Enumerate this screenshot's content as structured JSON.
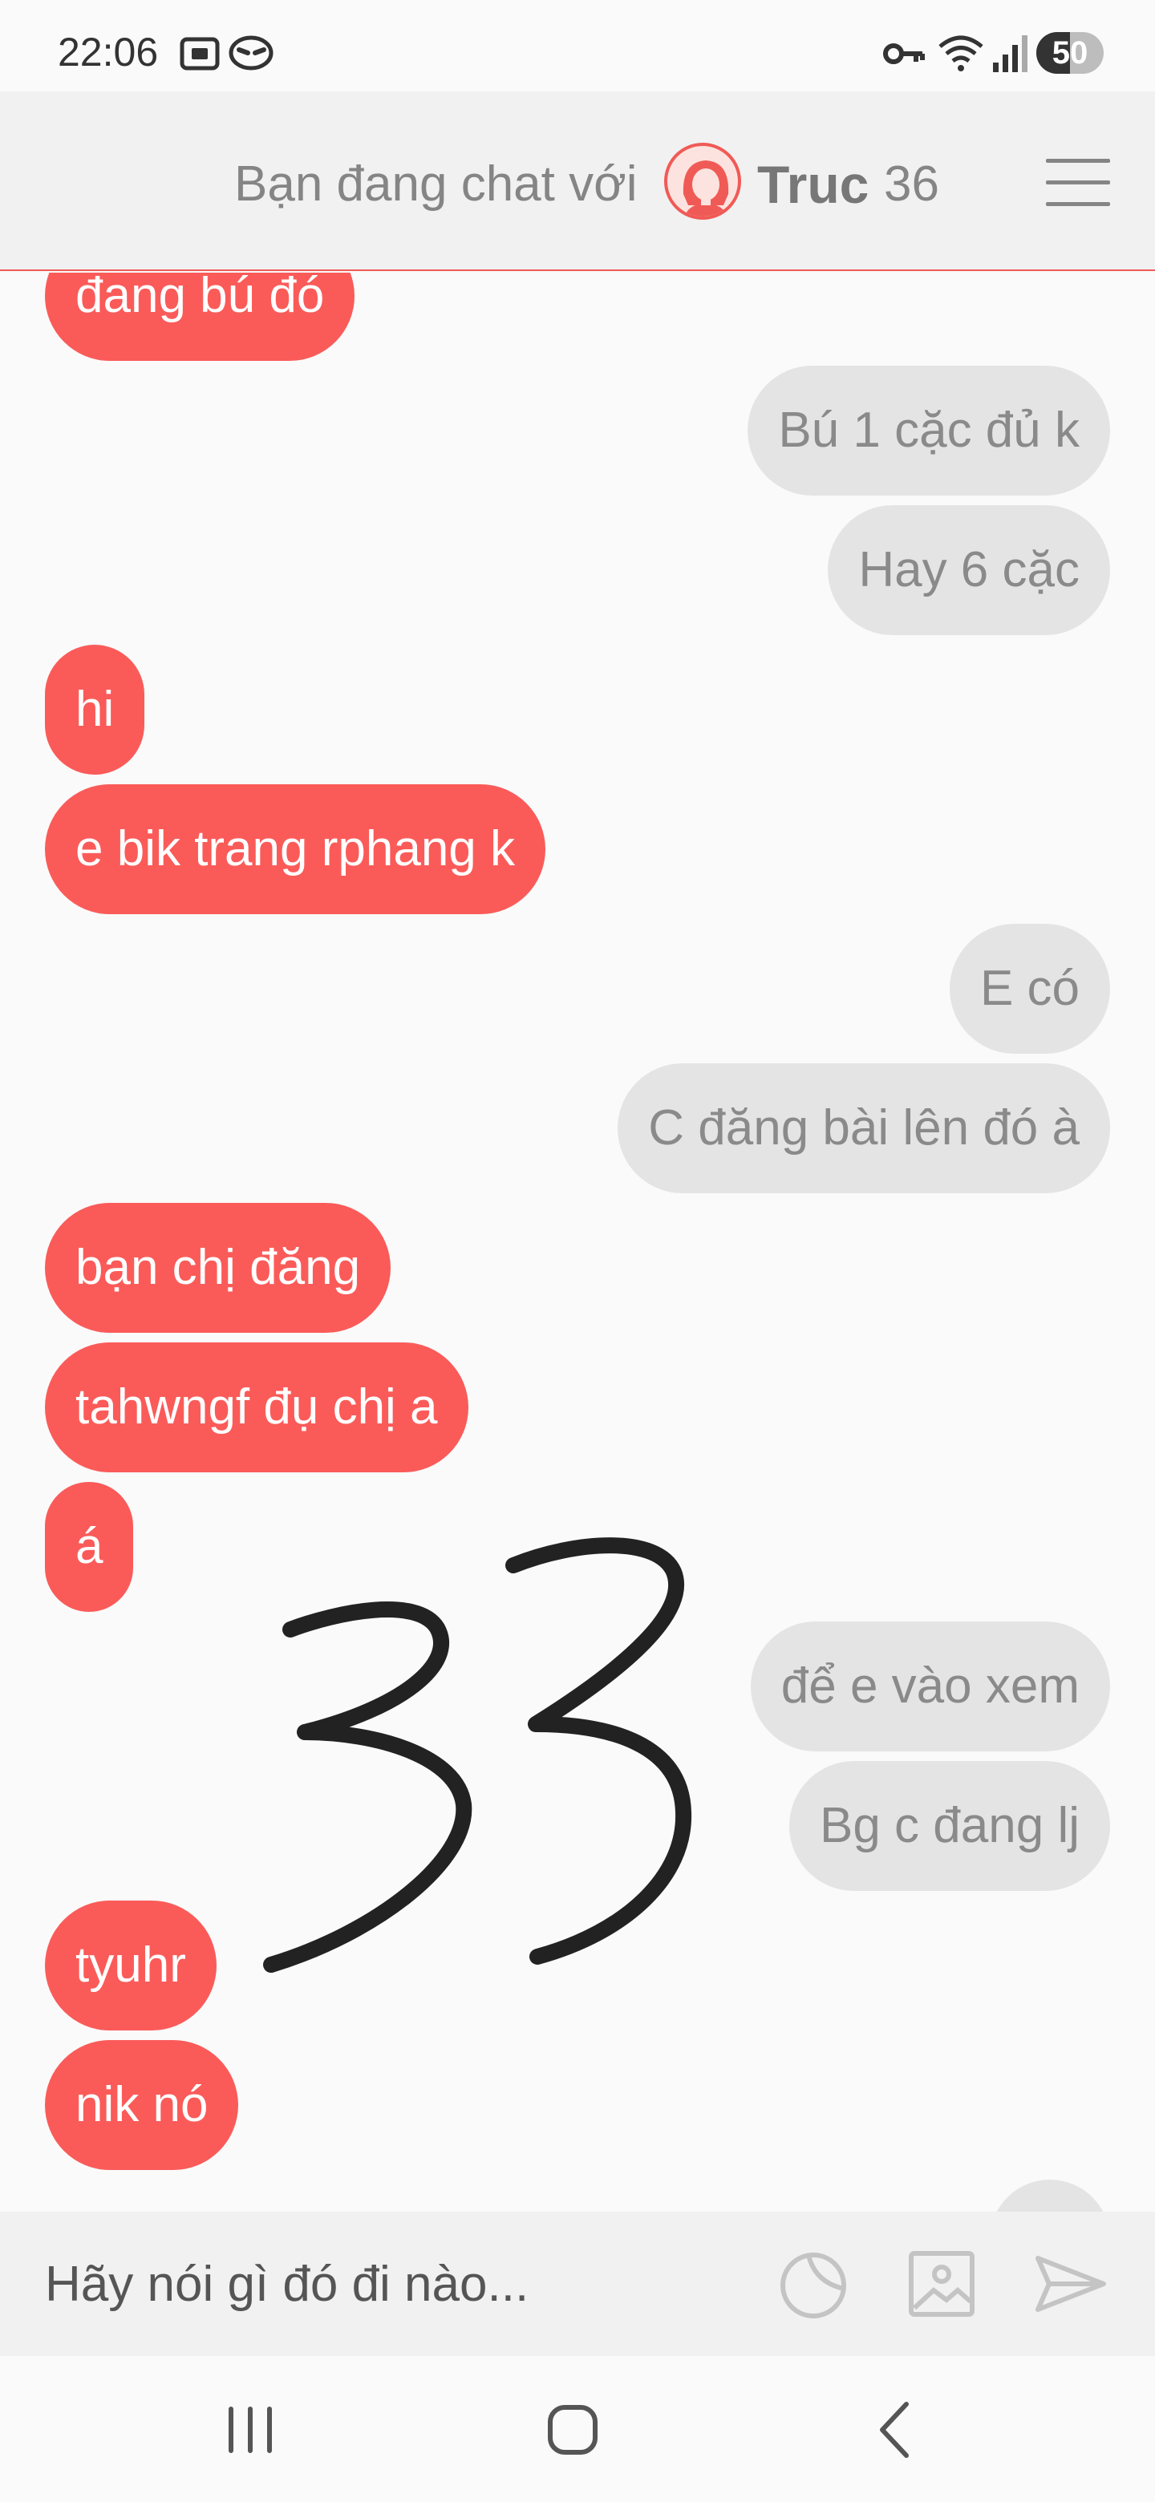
{
  "status_bar": {
    "time": "22:06",
    "battery": "50",
    "battery_level_percent": 50
  },
  "header": {
    "prefix": "Bạn đang chat với",
    "partner_name": "Truc",
    "count": "36"
  },
  "messages": [
    {
      "sender": "partner",
      "text": "đang bú đó"
    },
    {
      "sender": "me",
      "text": "Bú 1 cặc đủ k"
    },
    {
      "sender": "me",
      "text": "Hay 6 cặc"
    },
    {
      "sender": "partner",
      "text": "hi"
    },
    {
      "sender": "partner",
      "text": "e bik trang rphang k"
    },
    {
      "sender": "me",
      "text": "E có"
    },
    {
      "sender": "me",
      "text": "C đăng bài lên đó à"
    },
    {
      "sender": "partner",
      "text": "bạn chị đăng"
    },
    {
      "sender": "partner",
      "text": "tahwngf đụ chị a"
    },
    {
      "sender": "partner",
      "text": "á"
    },
    {
      "sender": "me",
      "text": "để e vào xem"
    },
    {
      "sender": "me",
      "text": "Bg c đang lj"
    },
    {
      "sender": "partner",
      "text": "tyuhr"
    },
    {
      "sender": "partner",
      "text": "nik nó"
    }
  ],
  "composer": {
    "placeholder": "Hãy nói gì đó đi nào..."
  },
  "icons": {
    "status": [
      "screenshot-icon",
      "messenger-icon",
      "vpn-key-icon",
      "wifi-icon",
      "signal-icon",
      "battery-icon"
    ],
    "header": [
      "avatar",
      "menu-icon"
    ],
    "composer": [
      "sticker-icon",
      "image-icon",
      "send-icon"
    ],
    "navbar": [
      "recent-apps-icon",
      "home-icon",
      "back-icon"
    ]
  },
  "colors": {
    "accent": "#fa5b59",
    "sent_bubble": "#e4e4e4",
    "header_bg": "#f1f1f1",
    "handwriting": "#222222"
  }
}
